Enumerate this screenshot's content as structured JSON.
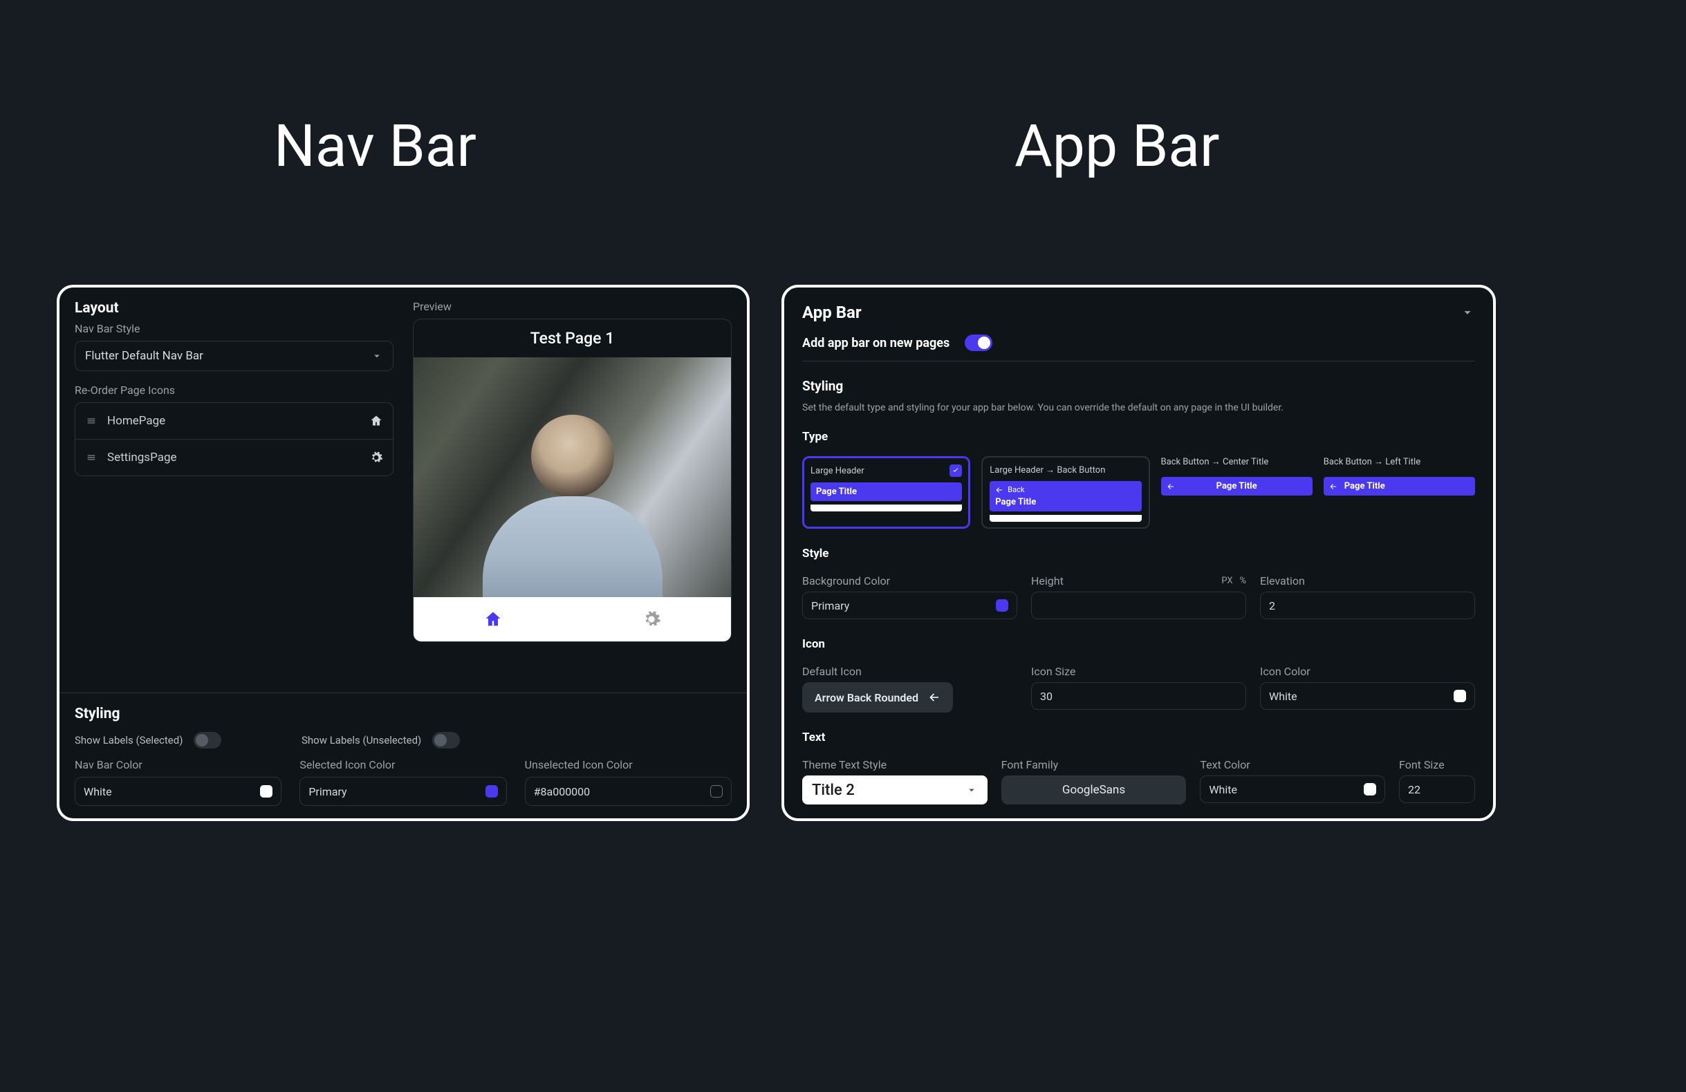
{
  "headlines": {
    "nav": "Nav Bar",
    "app": "App Bar"
  },
  "navPanel": {
    "layoutTitle": "Layout",
    "navBarStyleLabel": "Nav Bar Style",
    "navBarStyleValue": "Flutter Default Nav Bar",
    "reorderLabel": "Re-Order Page Icons",
    "pages": [
      {
        "name": "HomePage",
        "icon": "home"
      },
      {
        "name": "SettingsPage",
        "icon": "gear"
      }
    ],
    "previewLabel": "Preview",
    "previewTitle": "Test Page 1",
    "stylingTitle": "Styling",
    "showLabelsSelected": "Show Labels (Selected)",
    "showLabelsUnselected": "Show Labels (Unselected)",
    "toggles": {
      "selected": false,
      "unselected": false
    },
    "colors": {
      "navBar": {
        "label": "Nav Bar Color",
        "value": "White",
        "swatch": "white"
      },
      "selected": {
        "label": "Selected Icon Color",
        "value": "Primary",
        "swatch": "primary"
      },
      "unselected": {
        "label": "Unselected Icon Color",
        "value": "#8a000000",
        "swatch": "empty"
      }
    }
  },
  "appPanel": {
    "title": "App Bar",
    "addOnNewPagesLabel": "Add app bar on new pages",
    "addOnNewPagesOn": true,
    "stylingTitle": "Styling",
    "stylingHelp": "Set the default type and styling for your app bar below. You can override the default on any page in the UI builder.",
    "typeLabel": "Type",
    "types": [
      {
        "label": "Large Header",
        "selected": true,
        "mode": "large"
      },
      {
        "label": "Large Header → Back Button",
        "selected": false,
        "mode": "large-back"
      },
      {
        "label": "Back Button → Center Title",
        "selected": false,
        "mode": "center"
      },
      {
        "label": "Back Button → Left Title",
        "selected": false,
        "mode": "left"
      }
    ],
    "pageTitleText": "Page Title",
    "backText": "Back",
    "style": {
      "sectionLabel": "Style",
      "bgColor": {
        "label": "Background Color",
        "value": "Primary",
        "swatch": "primary"
      },
      "height": {
        "label": "Height",
        "unitPx": "PX",
        "unitPct": "%",
        "value": ""
      },
      "elevation": {
        "label": "Elevation",
        "value": "2"
      }
    },
    "icon": {
      "sectionLabel": "Icon",
      "defaultIcon": {
        "label": "Default Icon",
        "value": "Arrow Back Rounded"
      },
      "iconSize": {
        "label": "Icon Size",
        "value": "30"
      },
      "iconColor": {
        "label": "Icon Color",
        "value": "White",
        "swatch": "white"
      }
    },
    "text": {
      "sectionLabel": "Text",
      "themeStyle": {
        "label": "Theme Text Style",
        "value": "Title 2"
      },
      "fontFamily": {
        "label": "Font Family",
        "value": "GoogleSans"
      },
      "textColor": {
        "label": "Text Color",
        "value": "White",
        "swatch": "white"
      },
      "fontSize": {
        "label": "Font Size",
        "value": "22"
      }
    }
  }
}
